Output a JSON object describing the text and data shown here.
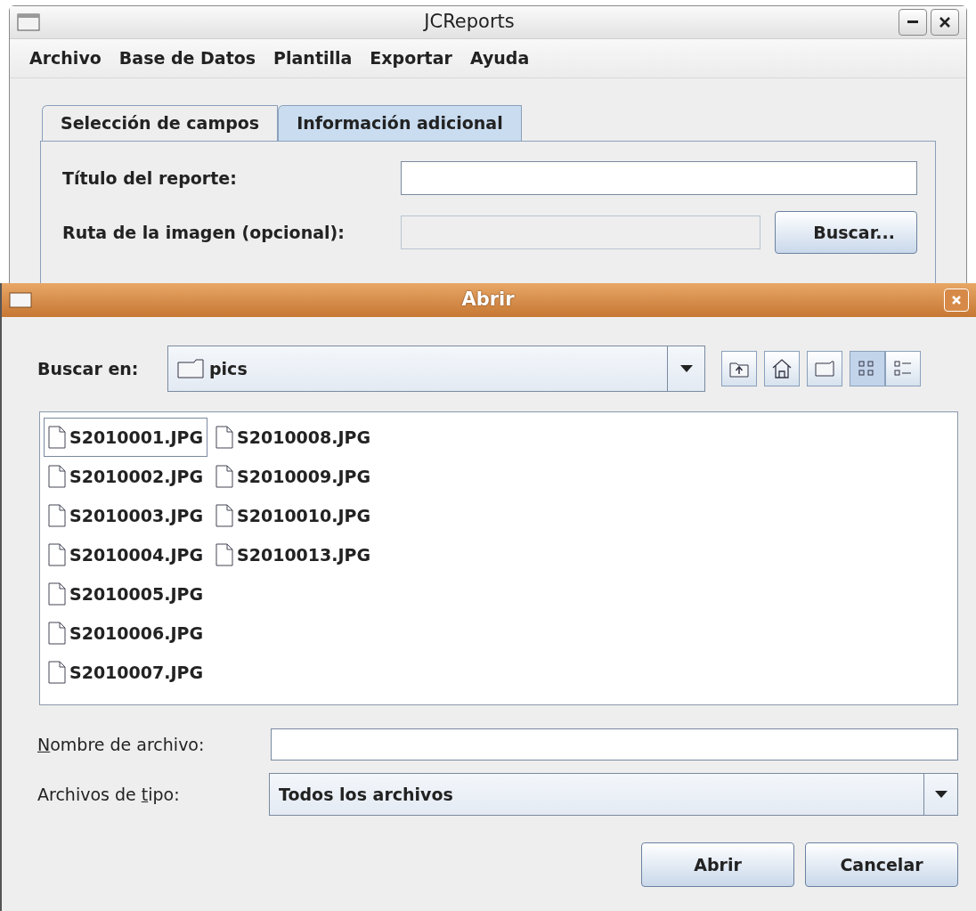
{
  "main_window": {
    "title": "JCReports",
    "menu": [
      "Archivo",
      "Base de Datos",
      "Plantilla",
      "Exportar",
      "Ayuda"
    ],
    "tabs": [
      {
        "label": "Selección de campos",
        "selected": false
      },
      {
        "label": "Información adicional",
        "selected": true
      }
    ],
    "fields": [
      {
        "label": "Título del reporte:",
        "disabled": false
      },
      {
        "label": "Ruta de la imagen (opcional):",
        "disabled": true,
        "button": "Buscar..."
      }
    ]
  },
  "dialog": {
    "title": "Abrir",
    "look_in": {
      "label": "Buscar en:",
      "value": "pics"
    },
    "toolbar": [
      {
        "kind": "up",
        "selected": false
      },
      {
        "kind": "home",
        "selected": false
      },
      {
        "kind": "new-folder",
        "selected": false
      },
      {
        "kind": "list",
        "selected": true
      },
      {
        "kind": "details",
        "selected": false
      }
    ],
    "files": [
      {
        "name": "S2010001.JPG",
        "focused": true
      },
      {
        "name": "S2010002.JPG",
        "focused": false
      },
      {
        "name": "S2010003.JPG",
        "focused": false
      },
      {
        "name": "S2010004.JPG",
        "focused": false
      },
      {
        "name": "S2010005.JPG",
        "focused": false
      },
      {
        "name": "S2010006.JPG",
        "focused": false
      },
      {
        "name": "S2010007.JPG",
        "focused": false
      },
      {
        "name": "S2010008.JPG",
        "focused": false
      },
      {
        "name": "S2010009.JPG",
        "focused": false
      },
      {
        "name": "S2010010.JPG",
        "focused": false
      },
      {
        "name": "S2010013.JPG",
        "focused": false
      }
    ],
    "file_name": {
      "label": {
        "mnemonic": "N",
        "after": "ombre de archivo:"
      }
    },
    "file_type": {
      "label": {
        "before": "Archivos de ",
        "mnemonic": "t",
        "after": "ipo:"
      },
      "value": "Todos los archivos"
    },
    "buttons": [
      "Abrir",
      "Cancelar"
    ]
  }
}
